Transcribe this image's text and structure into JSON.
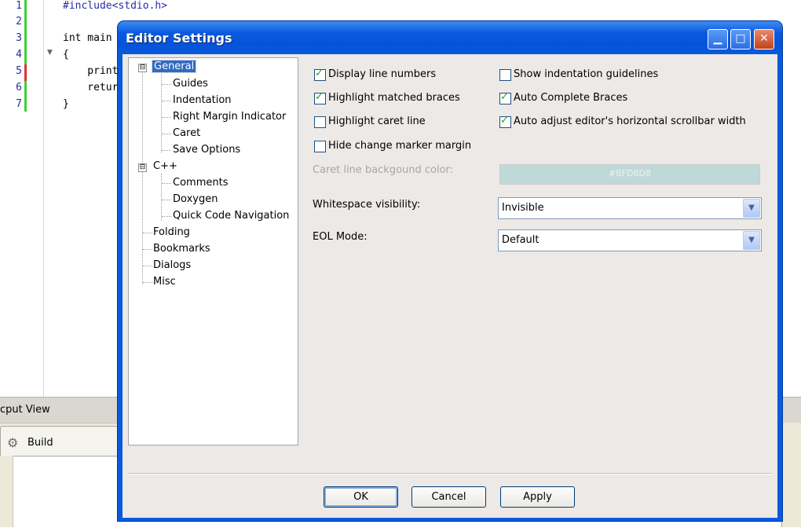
{
  "editor": {
    "line_numbers": [
      "1",
      "2",
      "3",
      "4",
      "5",
      "6",
      "7"
    ],
    "code_lines": [
      "#include<stdio.h>",
      "",
      "int main",
      "{",
      "    print",
      "    retur",
      "}"
    ]
  },
  "output_view": {
    "title": "cput View",
    "build_tab": "Build",
    "build_icon": "gear-icon"
  },
  "dialog": {
    "title": "Editor Settings",
    "titlebar_buttons": {
      "minimize": "minimize-icon",
      "maximize": "maximize-icon",
      "close": "close-icon"
    },
    "tree": {
      "general": {
        "label": "General",
        "expander": "⊟",
        "children": [
          "Guides",
          "Indentation",
          "Right Margin Indicator",
          "Caret",
          "Save Options"
        ]
      },
      "cpp": {
        "label": "C++",
        "expander": "⊟",
        "children": [
          "Comments",
          "Doxygen",
          "Quick Code Navigation"
        ]
      },
      "others": [
        "Folding",
        "Bookmarks",
        "Dialogs",
        "Misc"
      ]
    },
    "options": {
      "display_line_numbers": {
        "label": "Display line numbers",
        "checked": true
      },
      "highlight_matched_braces": {
        "label": "Highlight matched braces",
        "checked": true
      },
      "highlight_caret_line": {
        "label": "Highlight caret line",
        "checked": false
      },
      "hide_change_marker_margin": {
        "label": "Hide change marker margin",
        "checked": false
      },
      "show_indentation_guidelines": {
        "label": "Show indentation guidelines",
        "checked": false
      },
      "auto_complete_braces": {
        "label": "Auto Complete Braces",
        "checked": true
      },
      "auto_adjust_scrollbar": {
        "label": "Auto adjust editor's horizontal scrollbar width",
        "checked": true
      }
    },
    "caret_color": {
      "label": "Caret line backgound color:",
      "value": "#BFD8D8"
    },
    "whitespace": {
      "label": "Whitespace visibility:",
      "value": "Invisible"
    },
    "eol": {
      "label": "EOL Mode:",
      "value": "Default"
    },
    "buttons": {
      "ok": "OK",
      "cancel": "Cancel",
      "apply": "Apply"
    }
  }
}
